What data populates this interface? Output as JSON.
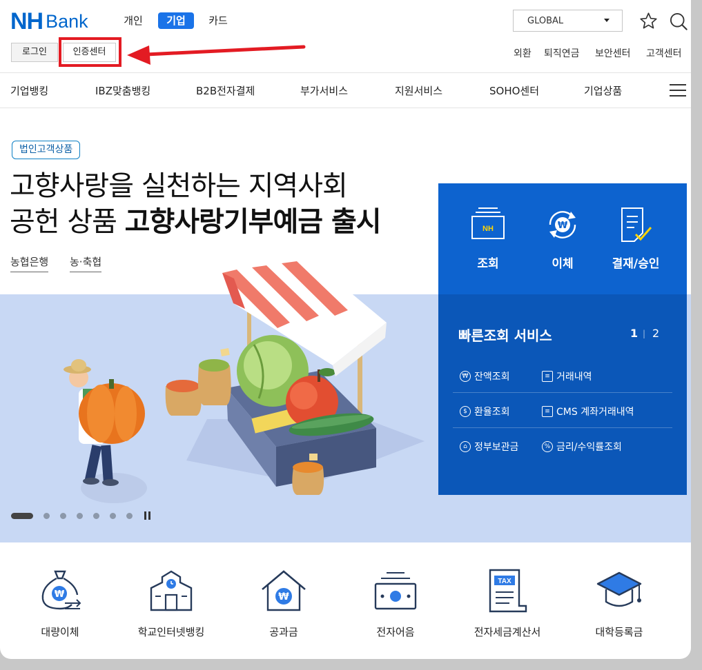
{
  "header": {
    "logo": {
      "nh": "NH",
      "bank": "Bank"
    },
    "tabs": [
      {
        "label": "개인",
        "active": false
      },
      {
        "label": "기업",
        "active": true
      },
      {
        "label": "카드",
        "active": false
      }
    ],
    "login_label": "로그인",
    "cert_label": "인증센터",
    "global_select": "GLOBAL",
    "util_links": [
      "외환",
      "퇴직연금",
      "보안센터",
      "고객센터"
    ]
  },
  "nav": [
    "기업뱅킹",
    "IBZ맞춤뱅킹",
    "B2B전자결제",
    "부가서비스",
    "지원서비스",
    "SOHO센터",
    "기업상품"
  ],
  "hero": {
    "badge": "법인고객상품",
    "line1": "고향사랑을 실천하는 지역사회",
    "line2_plain": "공헌 상품 ",
    "line2_bold": "고향사랑기부예금 출시",
    "tags": [
      "농협은행",
      "농·축협"
    ]
  },
  "panel": {
    "main": [
      {
        "label": "조회",
        "icon": "nh-card-icon"
      },
      {
        "label": "이체",
        "icon": "won-transfer-icon"
      },
      {
        "label": "결재/승인",
        "icon": "approval-doc-icon"
      }
    ],
    "quick_title": "빠른조회 서비스",
    "page_current": "1",
    "page_sep": "|",
    "page_next": "2",
    "quick_items": [
      {
        "label": "잔액조회",
        "icon": "₩"
      },
      {
        "label": "거래내역",
        "icon": "≡"
      },
      {
        "label": "환율조회",
        "icon": "$"
      },
      {
        "label": "CMS 계좌거래내역",
        "icon": "≡"
      },
      {
        "label": "정부보관금",
        "icon": "⌂"
      },
      {
        "label": "금리/수익률조회",
        "icon": "%"
      }
    ]
  },
  "bottom_services": [
    "대량이체",
    "학교인터넷뱅킹",
    "공과금",
    "전자어음",
    "전자세금계산서",
    "대학등록금"
  ],
  "tax_label": "TAX",
  "colors": {
    "brand": "#0066cc",
    "panel": "#0a5cc2",
    "band": "#c8d8f4",
    "annotation": "#e31b23"
  }
}
